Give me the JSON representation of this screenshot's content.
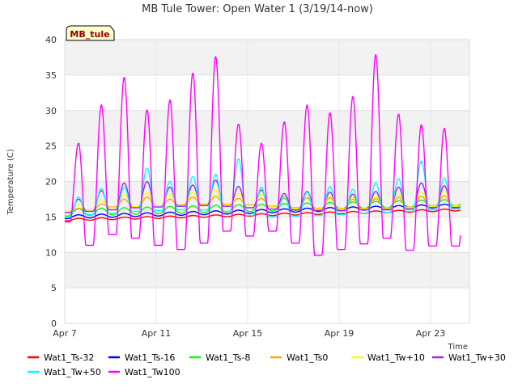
{
  "chart_data": {
    "type": "line",
    "title": "MB Tule Tower: Open Water 1 (3/19/14-now)",
    "xlabel": "Time",
    "ylabel": "Temperature (C)",
    "site_tag": "MB_tule",
    "xlim": [
      0,
      17.7
    ],
    "ylim": [
      0,
      40
    ],
    "yticks": [
      0,
      5,
      10,
      15,
      20,
      25,
      30,
      35,
      40
    ],
    "xticks": [
      {
        "value": 0,
        "label": "Apr 7"
      },
      {
        "value": 4,
        "label": "Apr 11"
      },
      {
        "value": 8,
        "label": "Apr 15"
      },
      {
        "value": 12,
        "label": "Apr 19"
      },
      {
        "value": 16,
        "label": "Apr 23"
      }
    ],
    "x_start": 0,
    "x_end": 17.3,
    "grid": true,
    "legend_position": "bottom",
    "series": [
      {
        "name": "Wat1_Ts-32",
        "color": "#ff0000",
        "kind": "trend",
        "start": 14.6,
        "end": 16.0,
        "amp": 0.15
      },
      {
        "name": "Wat1_Ts-16",
        "color": "#0000ff",
        "kind": "trend",
        "start": 15.0,
        "end": 16.6,
        "amp": 0.25
      },
      {
        "name": "Wat1_Ts-8",
        "color": "#00ff00",
        "kind": "trend",
        "start": 15.6,
        "end": 17.0,
        "amp": 0.5
      },
      {
        "name": "Wat1_Ts0",
        "color": "#ffa500",
        "kind": "diurnal",
        "maxs": [
          16.2,
          16.8,
          17.5,
          17.8,
          17.5,
          17.8,
          17.9,
          17.6,
          17.6,
          17.6,
          17.7,
          17.7,
          17.5,
          17.6,
          17.8,
          17.9,
          18.0,
          17.7
        ],
        "mins": [
          15.8,
          16.0,
          16.4,
          16.5,
          16.6,
          16.7,
          16.8,
          16.8,
          16.7,
          16.5,
          16.3,
          16.2,
          16.2,
          16.2,
          16.3,
          16.4,
          16.6,
          16.6
        ]
      },
      {
        "name": "Wat1_Tw+10",
        "color": "#ffff00",
        "kind": "diurnal",
        "maxs": [
          16.8,
          17.5,
          18.2,
          18.5,
          18.3,
          18.5,
          18.8,
          18.3,
          18.2,
          18.0,
          18.1,
          18.0,
          17.8,
          18.0,
          18.3,
          18.5,
          18.7,
          18.3
        ],
        "mins": [
          15.8,
          16.0,
          16.3,
          16.5,
          16.6,
          16.6,
          16.7,
          16.7,
          16.6,
          16.4,
          16.2,
          16.1,
          16.1,
          16.1,
          16.2,
          16.3,
          16.5,
          16.5
        ]
      },
      {
        "name": "Wat1_Tw+30",
        "color": "#a020f0",
        "kind": "diurnal",
        "maxs": [
          17.5,
          18.7,
          19.8,
          20.0,
          19.2,
          19.5,
          20.2,
          19.3,
          18.8,
          18.3,
          18.6,
          18.5,
          18.2,
          18.6,
          19.2,
          19.8,
          19.4,
          18.6
        ],
        "mins": [
          15.6,
          15.8,
          16.0,
          16.3,
          16.4,
          16.5,
          16.6,
          16.5,
          16.3,
          16.1,
          16.0,
          15.9,
          15.9,
          16.0,
          16.0,
          16.1,
          16.3,
          16.3
        ]
      },
      {
        "name": "Wat1_Tw+50",
        "color": "#00ffff",
        "kind": "diurnal",
        "maxs": [
          17.8,
          19.0,
          19.2,
          21.9,
          20.0,
          20.7,
          21.0,
          23.2,
          19.2,
          17.9,
          18.5,
          19.3,
          18.9,
          19.8,
          20.4,
          22.9,
          20.5,
          20.2
        ],
        "mins": [
          15.0,
          15.3,
          15.5,
          15.8,
          15.9,
          16.0,
          16.0,
          15.8,
          15.2,
          15.0,
          15.1,
          15.2,
          15.3,
          15.5,
          15.6,
          15.8,
          16.0,
          16.1
        ]
      },
      {
        "name": "Wat1_Tw100",
        "color": "#ff00ff",
        "kind": "diurnal",
        "maxs": [
          25.4,
          30.8,
          34.7,
          30.1,
          31.5,
          35.3,
          37.6,
          28.1,
          25.4,
          28.4,
          30.8,
          29.7,
          32.0,
          37.9,
          29.5,
          28.0,
          27.5,
          27.5
        ],
        "mins": [
          14.3,
          11.0,
          12.5,
          12.0,
          11.0,
          10.4,
          11.3,
          13.0,
          12.3,
          13.0,
          11.3,
          9.6,
          10.4,
          11.2,
          12.0,
          10.3,
          10.9,
          10.9
        ]
      }
    ]
  }
}
